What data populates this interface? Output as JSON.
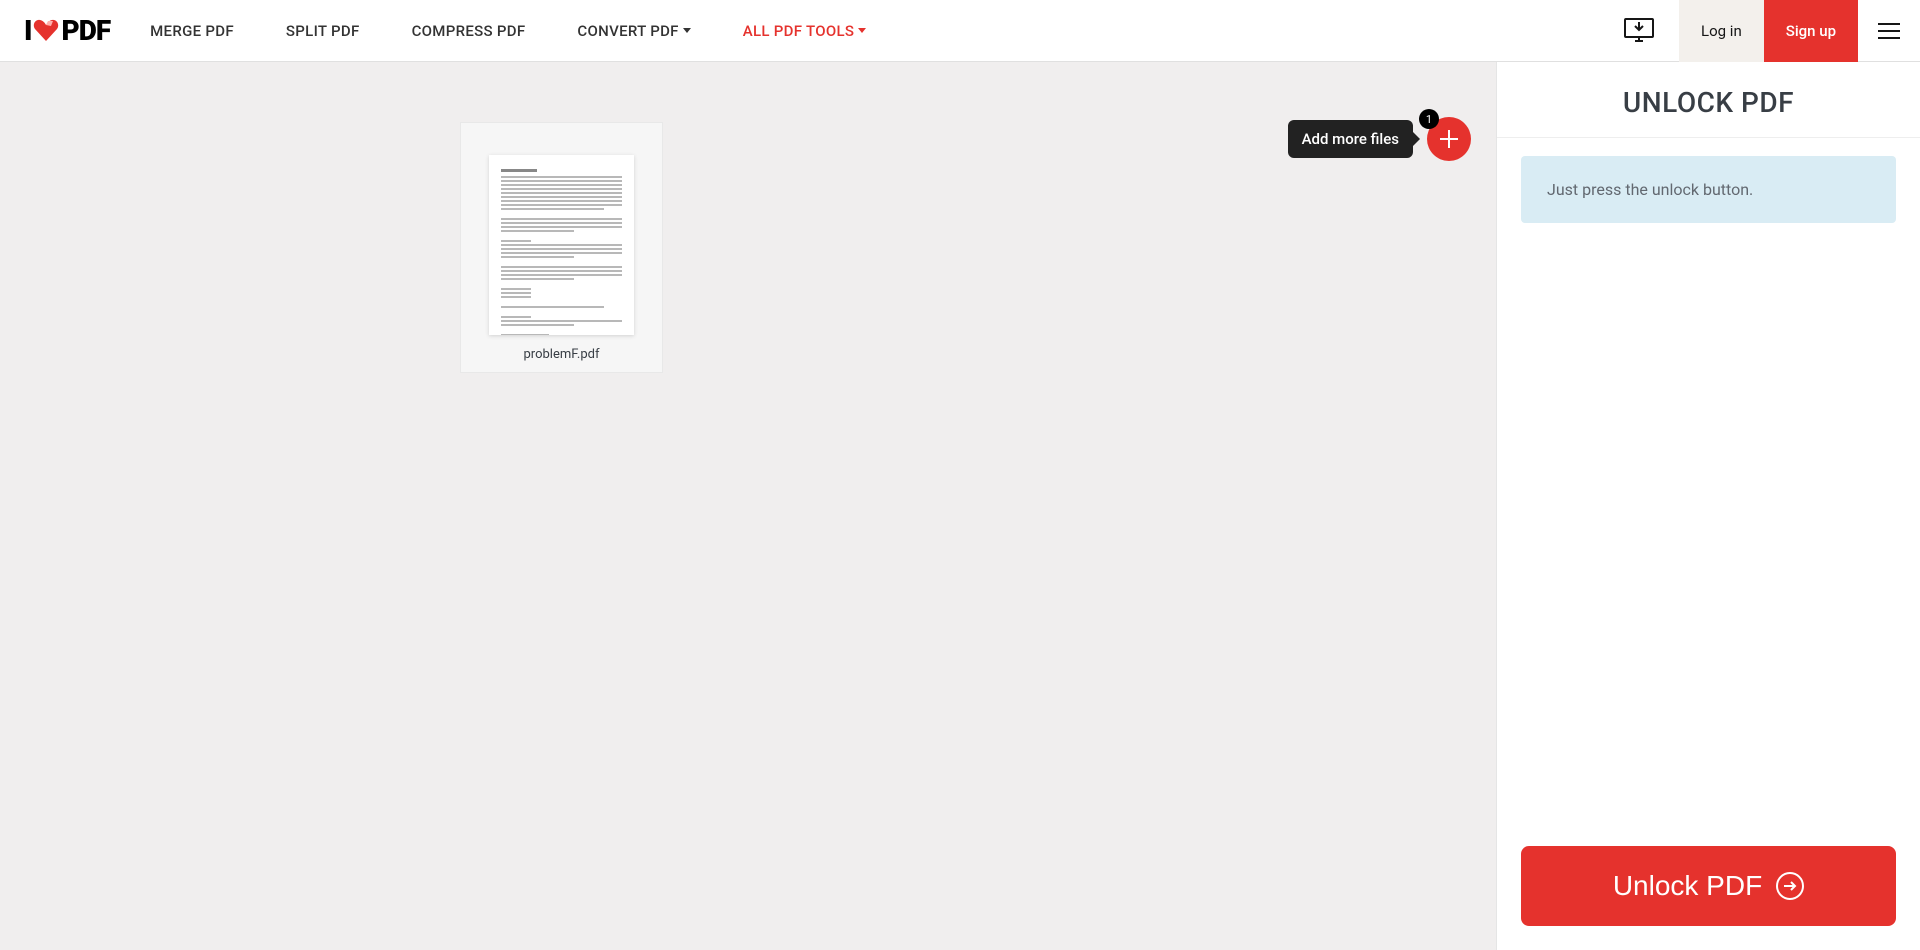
{
  "header": {
    "logo_parts": {
      "i": "I",
      "pdf": "PDF"
    },
    "nav": {
      "merge": "MERGE PDF",
      "split": "SPLIT PDF",
      "compress": "COMPRESS PDF",
      "convert": "CONVERT PDF",
      "all_tools": "ALL PDF TOOLS"
    },
    "login": "Log in",
    "signup": "Sign up"
  },
  "workspace": {
    "file_name": "problemF.pdf",
    "add_more_tooltip": "Add more files",
    "add_badge_count": "1"
  },
  "sidebar": {
    "title": "UNLOCK PDF",
    "info_text": "Just press the unlock button.",
    "unlock_button": "Unlock PDF"
  }
}
